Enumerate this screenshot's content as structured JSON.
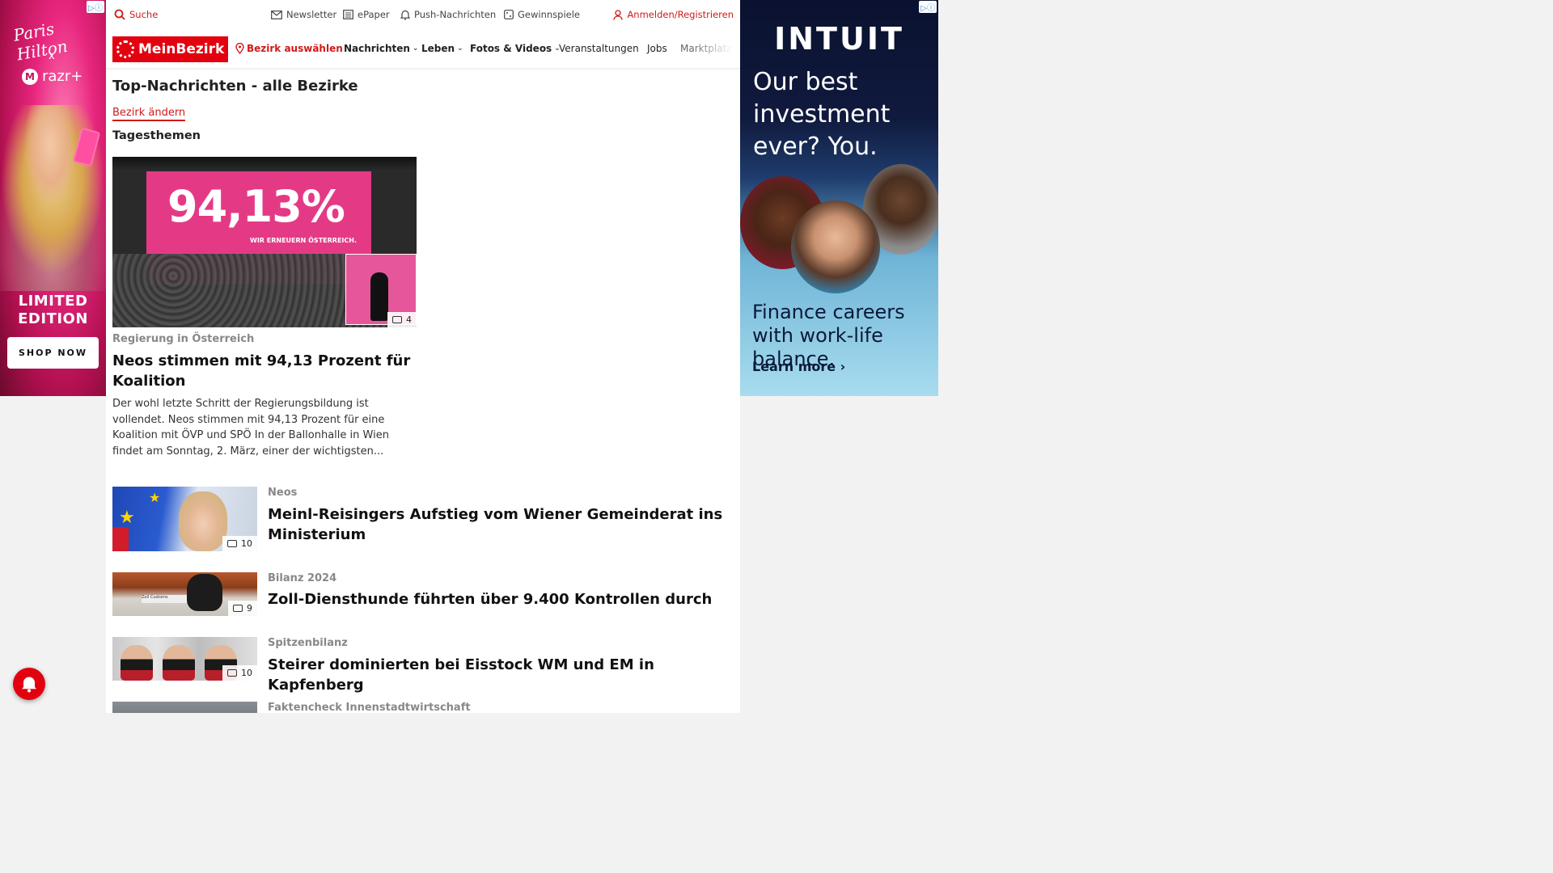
{
  "ads": {
    "left": {
      "adchoices": "▷ⓘ",
      "brand": "Paris Hilton",
      "cross": "x",
      "partner": "razr+",
      "headline": "LIMITED EDITION",
      "cta": "SHOP NOW"
    },
    "right": {
      "adchoices": "▷ⓘ",
      "logo": "INTUIT",
      "headline": "Our best investment ever? You.",
      "subline": "Finance careers with work-life balance.",
      "cta": "Learn more ›"
    }
  },
  "utility": {
    "search": "Suche",
    "newsletter": "Newsletter",
    "epaper": "ePaper",
    "push": "Push-Nachrichten",
    "games": "Gewinnspiele",
    "login": "Anmelden/Registrieren"
  },
  "nav": {
    "logo": "MeinBezirk",
    "bezirk": "Bezirk auswählen",
    "nachrichten": "Nachrichten",
    "leben": "Leben",
    "fotos": "Fotos & Videos",
    "veranstaltungen": "Veranstaltungen",
    "jobs": "Jobs",
    "markt": "Marktplatz"
  },
  "page": {
    "title": "Top-Nachrichten - alle Bezirke",
    "change_bezirk": "Bezirk ändern",
    "section": "Tagesthemen"
  },
  "hero": {
    "image_text": "94,13%",
    "image_slogan": "WIR ERNEUERN ÖSTERREICH.",
    "photo_count": "4",
    "kicker": "Regierung in Österreich",
    "title": "Neos stimmen mit 94,13 Prozent für Koalition",
    "teaser": "Der wohl letzte Schritt der Regierungsbildung ist vollendet. Neos stimmen mit 94,13 Prozent für eine Koalition mit ÖVP und SPÖ In der Ballonhalle in Wien findet am Sonntag, 2. März, einer der wichtigsten..."
  },
  "articles": [
    {
      "kicker": "Neos",
      "title": "Meinl-Reisingers Aufstieg vom Wiener Gemeinderat ins Ministerium",
      "photo_count": "10"
    },
    {
      "kicker": "Bilanz 2024",
      "title": "Zoll-Diensthunde führten über 9.400 Kontrollen durch",
      "photo_count": "9",
      "thumb_tag": "Zoll Customs"
    },
    {
      "kicker": "Spitzenbilanz",
      "title": "Steirer dominierten bei Eisstock WM und EM in Kapfenberg",
      "photo_count": "10"
    },
    {
      "kicker": "Faktencheck Innenstadtwirtschaft"
    }
  ],
  "colors": {
    "brand_red": "#e3000f",
    "accent_red": "#d11a1a"
  }
}
